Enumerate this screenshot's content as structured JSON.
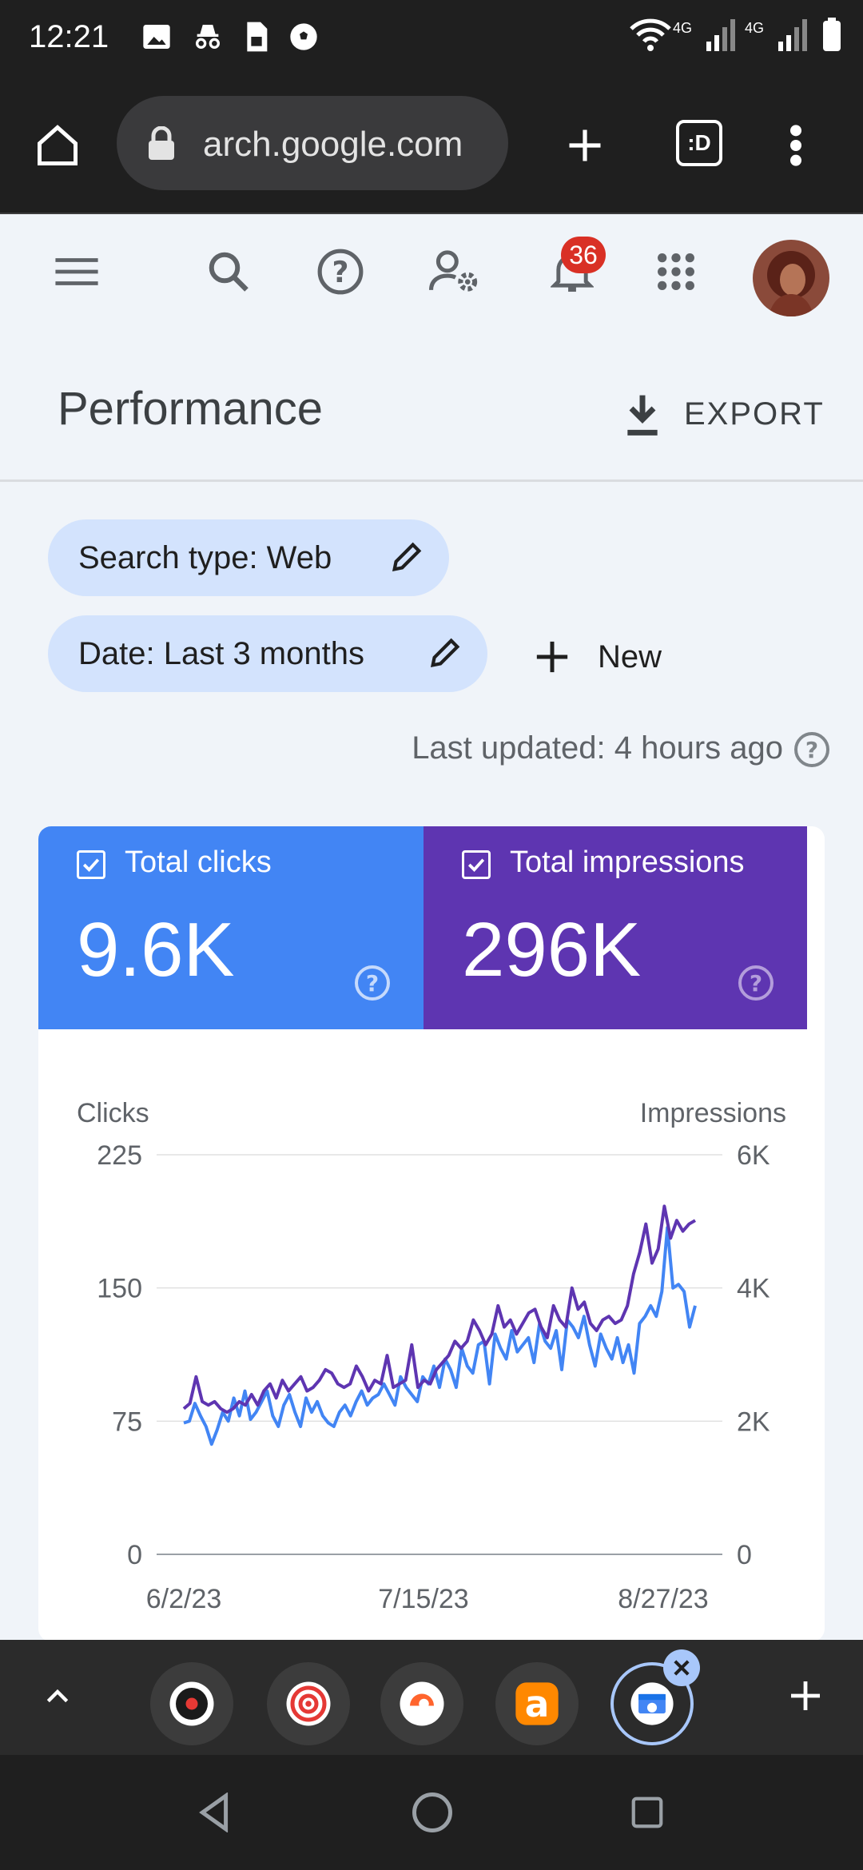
{
  "status": {
    "time": "12:21",
    "net1": "4G",
    "net2": "4G"
  },
  "browser": {
    "url": "arch.google.com",
    "tabs_label": ":D"
  },
  "header": {
    "notifications": "36"
  },
  "page": {
    "title": "Performance",
    "export_label": "EXPORT"
  },
  "filters": {
    "search_type": "Search type: Web",
    "date": "Date: Last 3 months",
    "new_label": "New",
    "last_updated": "Last updated: 4 hours ago"
  },
  "metrics": {
    "clicks_label": "Total clicks",
    "clicks_value": "9.6K",
    "impressions_label": "Total impressions",
    "impressions_value": "296K"
  },
  "colors": {
    "clicks": "#4285f4",
    "impressions": "#5e35b1"
  },
  "chart_data": {
    "type": "line",
    "left_axis_label": "Clicks",
    "right_axis_label": "Impressions",
    "left_ticks": [
      "225",
      "150",
      "75",
      "0"
    ],
    "right_ticks": [
      "6K",
      "4K",
      "2K",
      "0"
    ],
    "x_ticks": [
      "6/2/23",
      "7/15/23",
      "8/27/23"
    ],
    "ylim_left": [
      0,
      225
    ],
    "ylim_right": [
      0,
      6000
    ],
    "series": [
      {
        "name": "Clicks",
        "axis": "left",
        "color": "#4285f4",
        "values": [
          74,
          75,
          85,
          78,
          72,
          62,
          70,
          80,
          75,
          88,
          78,
          92,
          76,
          80,
          86,
          92,
          78,
          72,
          84,
          90,
          80,
          72,
          88,
          80,
          86,
          78,
          74,
          72,
          80,
          84,
          78,
          86,
          92,
          84,
          88,
          90,
          96,
          90,
          84,
          100,
          94,
          90,
          86,
          100,
          96,
          106,
          94,
          110,
          104,
          94,
          116,
          106,
          102,
          118,
          120,
          96,
          124,
          116,
          110,
          126,
          114,
          118,
          122,
          108,
          130,
          120,
          116,
          126,
          104,
          132,
          128,
          122,
          134,
          118,
          106,
          124,
          116,
          110,
          122,
          108,
          118,
          102,
          130,
          134,
          140,
          134,
          148,
          184,
          150,
          152,
          148,
          128,
          140
        ]
      },
      {
        "name": "Impressions",
        "axis": "left",
        "color": "#5e35b1",
        "values": [
          82,
          85,
          100,
          86,
          84,
          86,
          82,
          80,
          82,
          86,
          84,
          90,
          84,
          92,
          96,
          88,
          98,
          92,
          96,
          100,
          92,
          94,
          98,
          104,
          102,
          96,
          94,
          96,
          106,
          100,
          92,
          98,
          96,
          112,
          94,
          96,
          98,
          118,
          94,
          98,
          96,
          104,
          108,
          112,
          120,
          116,
          120,
          132,
          126,
          118,
          124,
          140,
          128,
          132,
          124,
          130,
          136,
          138,
          128,
          122,
          140,
          132,
          128,
          150,
          138,
          142,
          130,
          126,
          132,
          134,
          130,
          132,
          140,
          158,
          170,
          186,
          164,
          172,
          196,
          178,
          188,
          182,
          186,
          188
        ]
      }
    ]
  }
}
